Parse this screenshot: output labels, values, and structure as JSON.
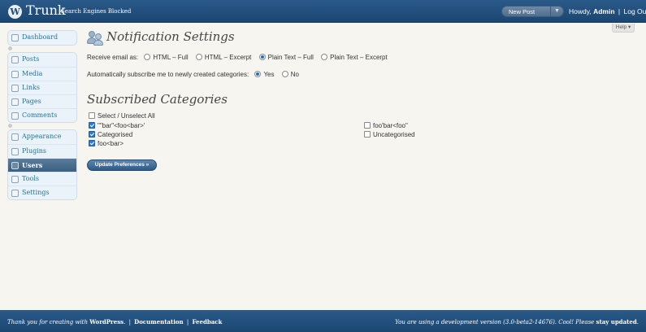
{
  "header": {
    "logo": "W",
    "site_title": "Trunk",
    "site_visibility": "Search Engines Blocked",
    "favorite_action": "New Post",
    "favorite_toggle": "▼",
    "greeting": "Howdy,",
    "username": "Admin",
    "separator": "|",
    "logout": "Log Out"
  },
  "help_tab": "Help ▾",
  "menu": {
    "dashboard": "Dashboard",
    "group1": [
      "Posts",
      "Media",
      "Links",
      "Pages",
      "Comments"
    ],
    "group2": [
      "Appearance",
      "Plugins",
      "Users",
      "Tools",
      "Settings"
    ],
    "current": "Users"
  },
  "page": {
    "title": "Notification Settings",
    "receive_label": "Receive email as:",
    "receive_options": [
      "HTML – Full",
      "HTML – Excerpt",
      "Plain Text – Full",
      "Plain Text – Excerpt"
    ],
    "receive_selected": "Plain Text – Full",
    "auto_label": "Automatically subscribe me to newly created categories:",
    "auto_options": [
      "Yes",
      "No"
    ],
    "auto_selected": "Yes",
    "subscribed_title": "Subscribed Categories",
    "select_all": "Select / Unselect All",
    "categories_left": [
      {
        "label": "\"\"bar\"<foo<bar>'",
        "checked": true
      },
      {
        "label": "Categorised",
        "checked": true
      },
      {
        "label": "foo<bar>",
        "checked": true
      }
    ],
    "categories_right": [
      {
        "label": "foo'bar<foo\"",
        "checked": false
      },
      {
        "label": "Uncategorised",
        "checked": false
      }
    ],
    "submit": "Update Preferences »"
  },
  "footer": {
    "thanks_prefix": "Thank you for creating with",
    "wordpress": "WordPress",
    "separator": "|",
    "documentation": "Documentation",
    "feedback": "Feedback",
    "version_text": "You are using a development version (3.0-beta2-14676). Cool! Please",
    "stay_updated": "stay updated"
  }
}
